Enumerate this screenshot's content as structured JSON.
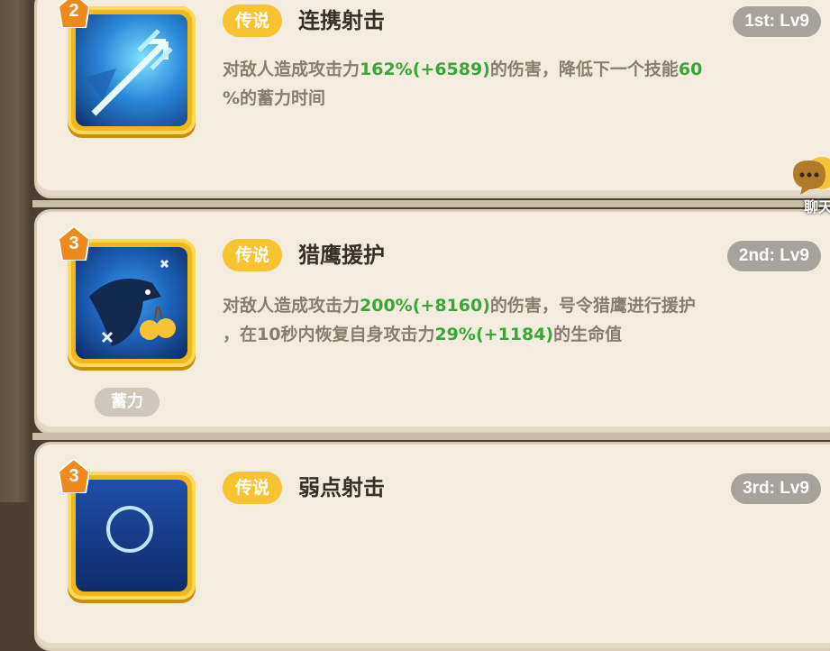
{
  "skills": [
    {
      "rarity": "传说",
      "name": "连携射击",
      "level": "1st: Lv9",
      "badge_number": "2",
      "desc_parts": [
        "对敌人造成攻击力",
        "162%",
        "(+6589)",
        "的伤害，降低下一个技能",
        "60",
        "%的蓄力时间"
      ],
      "icon": "trident-icon"
    },
    {
      "rarity": "传说",
      "name": "猎鹰援护",
      "level": "2nd: Lv9",
      "badge_number": "3",
      "tag": "蓄力",
      "desc_line1_parts": [
        "对敌人造成攻击力",
        "200%",
        "(+8160)",
        "的伤害，号令猎鹰进行援护"
      ],
      "desc_line2_parts": [
        "，在10秒内恢复自身攻击力",
        "29%",
        "(+1184)",
        "的生命值"
      ],
      "icon": "falcon-icon"
    },
    {
      "rarity": "传说",
      "name": "弱点射击",
      "level": "3rd: Lv9",
      "badge_number": "3",
      "icon": "weak-point-icon"
    }
  ],
  "chat_button": {
    "label": "聊天",
    "icon": "chat-bubble-icon"
  },
  "colors": {
    "accent_gold": "#f7c330",
    "value_green": "#3aa635",
    "panel_bg": "#f3ecdf"
  }
}
